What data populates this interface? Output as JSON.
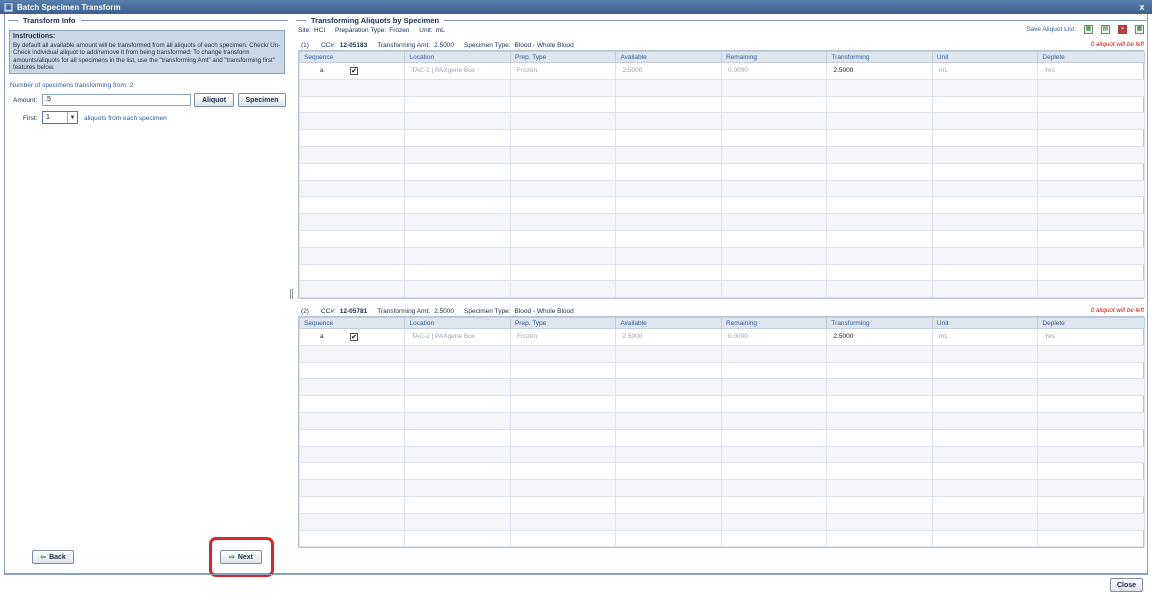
{
  "window": {
    "title": "Batch Specimen Transform",
    "close_glyph": "x"
  },
  "left": {
    "section_title": "Transform Info",
    "instructions_title": "Instructions:",
    "instructions_text": "By default all available amount will be transformed from all aliquots of each specimen. Check/ Un-Check individual aliquot to add/remove it from being transformed. To change transform amounts/aliquots for all specimens in the list, use the \"transforming Amt\" and \"transforming first\" features below.",
    "count_text": "Number of specimens transforming from: 2",
    "amount_label": "Amount:",
    "amount_value": ".5",
    "aliquot_button": "Aliquot",
    "specimen_button": "Specimen",
    "first_label": "First:",
    "first_value": "1",
    "first_suffix": "aliquots from each specimen",
    "back_button": "Back",
    "next_button": "Next"
  },
  "right": {
    "section_title": "Transforming Aliquots by Specimen",
    "site_label": "Site:",
    "site_value": "HCI",
    "prep_label": "Preparation Type:",
    "prep_value": "Frozen",
    "unit_label": "Unit:",
    "unit_value": "mL",
    "save_list_label": "Save Aliquot List:",
    "columns": [
      "Sequence",
      "Location",
      "Prep. Type",
      "Available",
      "Remaining",
      "Transforming",
      "Unit",
      "Deplete"
    ],
    "specimens": [
      {
        "index": "(1)",
        "cc_label": "CC#:",
        "cc_value": "12-05183",
        "amt_label": "Transforming Amt:",
        "amt_value": "2.5000",
        "type_label": "Specimen Type:",
        "type_value": "Blood - Whole Blood",
        "left_note": "0 aliquot will be left",
        "row": {
          "sequence": "a",
          "checked": "✔",
          "location": "TAC-2 | PAXgene Box",
          "prep_type": "Frozen",
          "available": "2.5000",
          "remaining": "0.0000",
          "transforming": "2.5000",
          "unit": "mL",
          "deplete": "Yes"
        }
      },
      {
        "index": "(2)",
        "cc_label": "CC#:",
        "cc_value": "12-05781",
        "amt_label": "Transforming Amt:",
        "amt_value": "2.5000",
        "type_label": "Specimen Type:",
        "type_value": "Blood - Whole Blood",
        "left_note": "0 aliquot will be left",
        "row": {
          "sequence": "a",
          "checked": "✔",
          "location": "TAC-2 | PAXgene Box",
          "prep_type": "Frozen",
          "available": "2.5000",
          "remaining": "0.0000",
          "transforming": "2.5000",
          "unit": "mL",
          "deplete": "Yes"
        }
      }
    ]
  },
  "footer": {
    "close_button": "Close"
  },
  "colors": {
    "title_bar": "#3c5f8f",
    "highlight": "#d8262a",
    "warning_text": "#d01010"
  }
}
